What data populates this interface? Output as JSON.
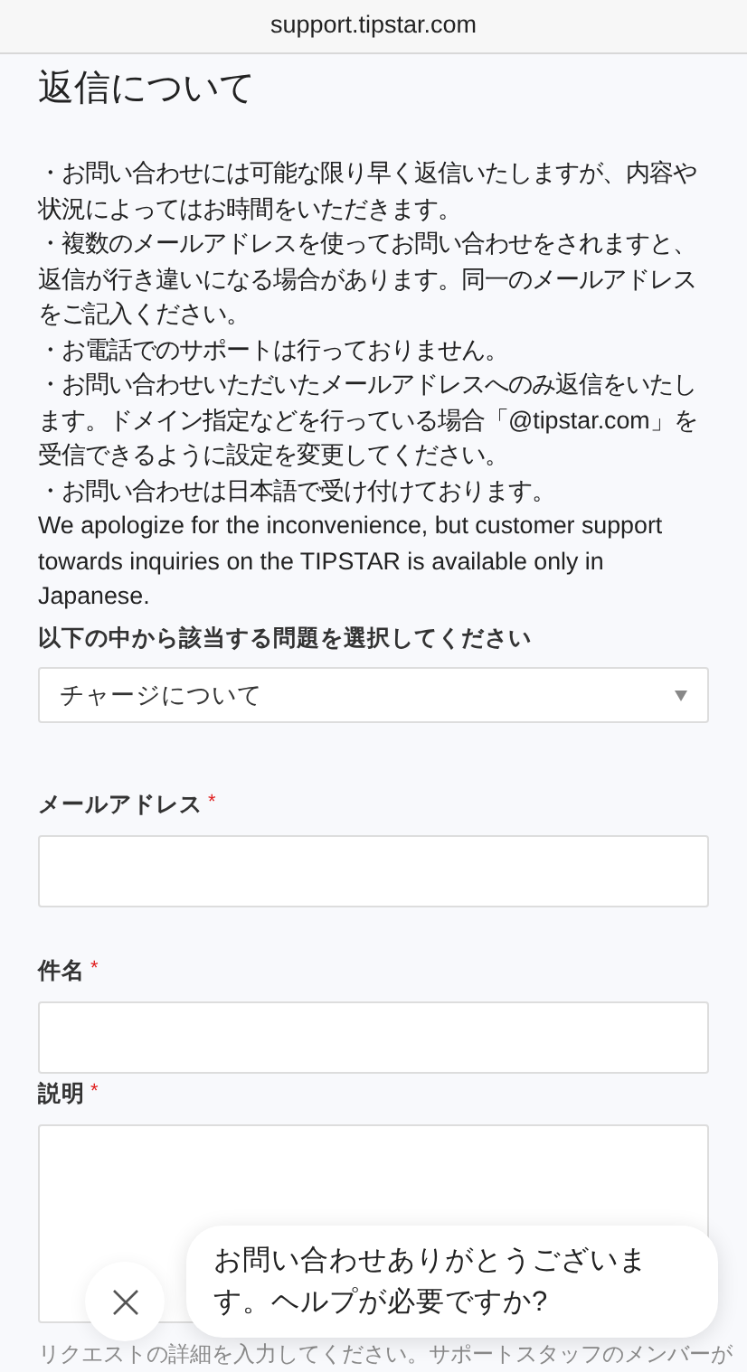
{
  "address_bar": {
    "url": "support.tipstar.com"
  },
  "heading": "返信について",
  "notices": [
    "・お問い合わせには可能な限り早く返信いたしますが、内容や状況によってはお時間をいただきます。",
    "・複数のメールアドレスを使ってお問い合わせをされますと、返信が行き違いになる場合があります。同一のメールアドレスをご記入ください。",
    "・お電話でのサポートは行っておりません。",
    "・お問い合わせいただいたメールアドレスへのみ返信をいたします。ドメイン指定などを行っている場合「@tipstar.com」を受信できるように設定を変更してください。",
    "・お問い合わせは日本語で受け付けております。",
    "We apologize for the inconvenience, but customer support towards inquiries on the TIPSTAR is available only in Japanese."
  ],
  "form": {
    "select": {
      "label": "以下の中から該当する問題を選択してください",
      "value": "チャージについて"
    },
    "fields": [
      {
        "kind": "input",
        "label": "メールアドレス",
        "required_mark": "*"
      },
      {
        "kind": "input",
        "label": "件名",
        "required_mark": "*"
      },
      {
        "kind": "textarea",
        "label": "説明",
        "required_mark": "*",
        "hint": "リクエストの詳細を入力してください。サポートスタッフのメンバーが"
      }
    ]
  },
  "chat_popup": {
    "message": "お問い合わせありがとうございます。ヘルプが必要ですか?"
  }
}
